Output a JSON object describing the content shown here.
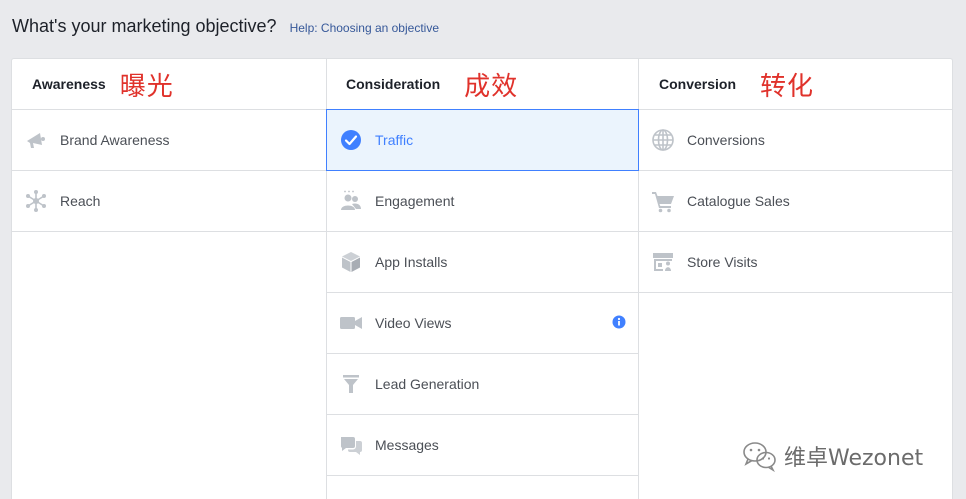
{
  "header": {
    "title": "What's your marketing objective?",
    "help_link": "Help: Choosing an objective"
  },
  "columns": [
    {
      "title": "Awareness",
      "annotation": "曝光",
      "items": [
        {
          "label": "Brand Awareness",
          "icon": "megaphone-icon"
        },
        {
          "label": "Reach",
          "icon": "reach-icon"
        }
      ]
    },
    {
      "title": "Consideration",
      "annotation": "成效",
      "items": [
        {
          "label": "Traffic",
          "icon": "check-circle-icon",
          "selected": true
        },
        {
          "label": "Engagement",
          "icon": "people-icon"
        },
        {
          "label": "App Installs",
          "icon": "cube-icon"
        },
        {
          "label": "Video Views",
          "icon": "video-camera-icon",
          "info_icon": true
        },
        {
          "label": "Lead Generation",
          "icon": "funnel-icon"
        },
        {
          "label": "Messages",
          "icon": "chat-bubbles-icon"
        }
      ]
    },
    {
      "title": "Conversion",
      "annotation": "转化",
      "items": [
        {
          "label": "Conversions",
          "icon": "globe-icon"
        },
        {
          "label": "Catalogue Sales",
          "icon": "shopping-cart-icon"
        },
        {
          "label": "Store Visits",
          "icon": "store-icon"
        }
      ]
    }
  ],
  "watermark": {
    "text": "维卓Wezonet",
    "icon": "wechat-icon"
  },
  "colors": {
    "accent": "#4080ff",
    "selected_bg": "#ebf4fd",
    "annotation": "#e0322b",
    "icon_gray": "#bec3c9",
    "link": "#365899"
  }
}
